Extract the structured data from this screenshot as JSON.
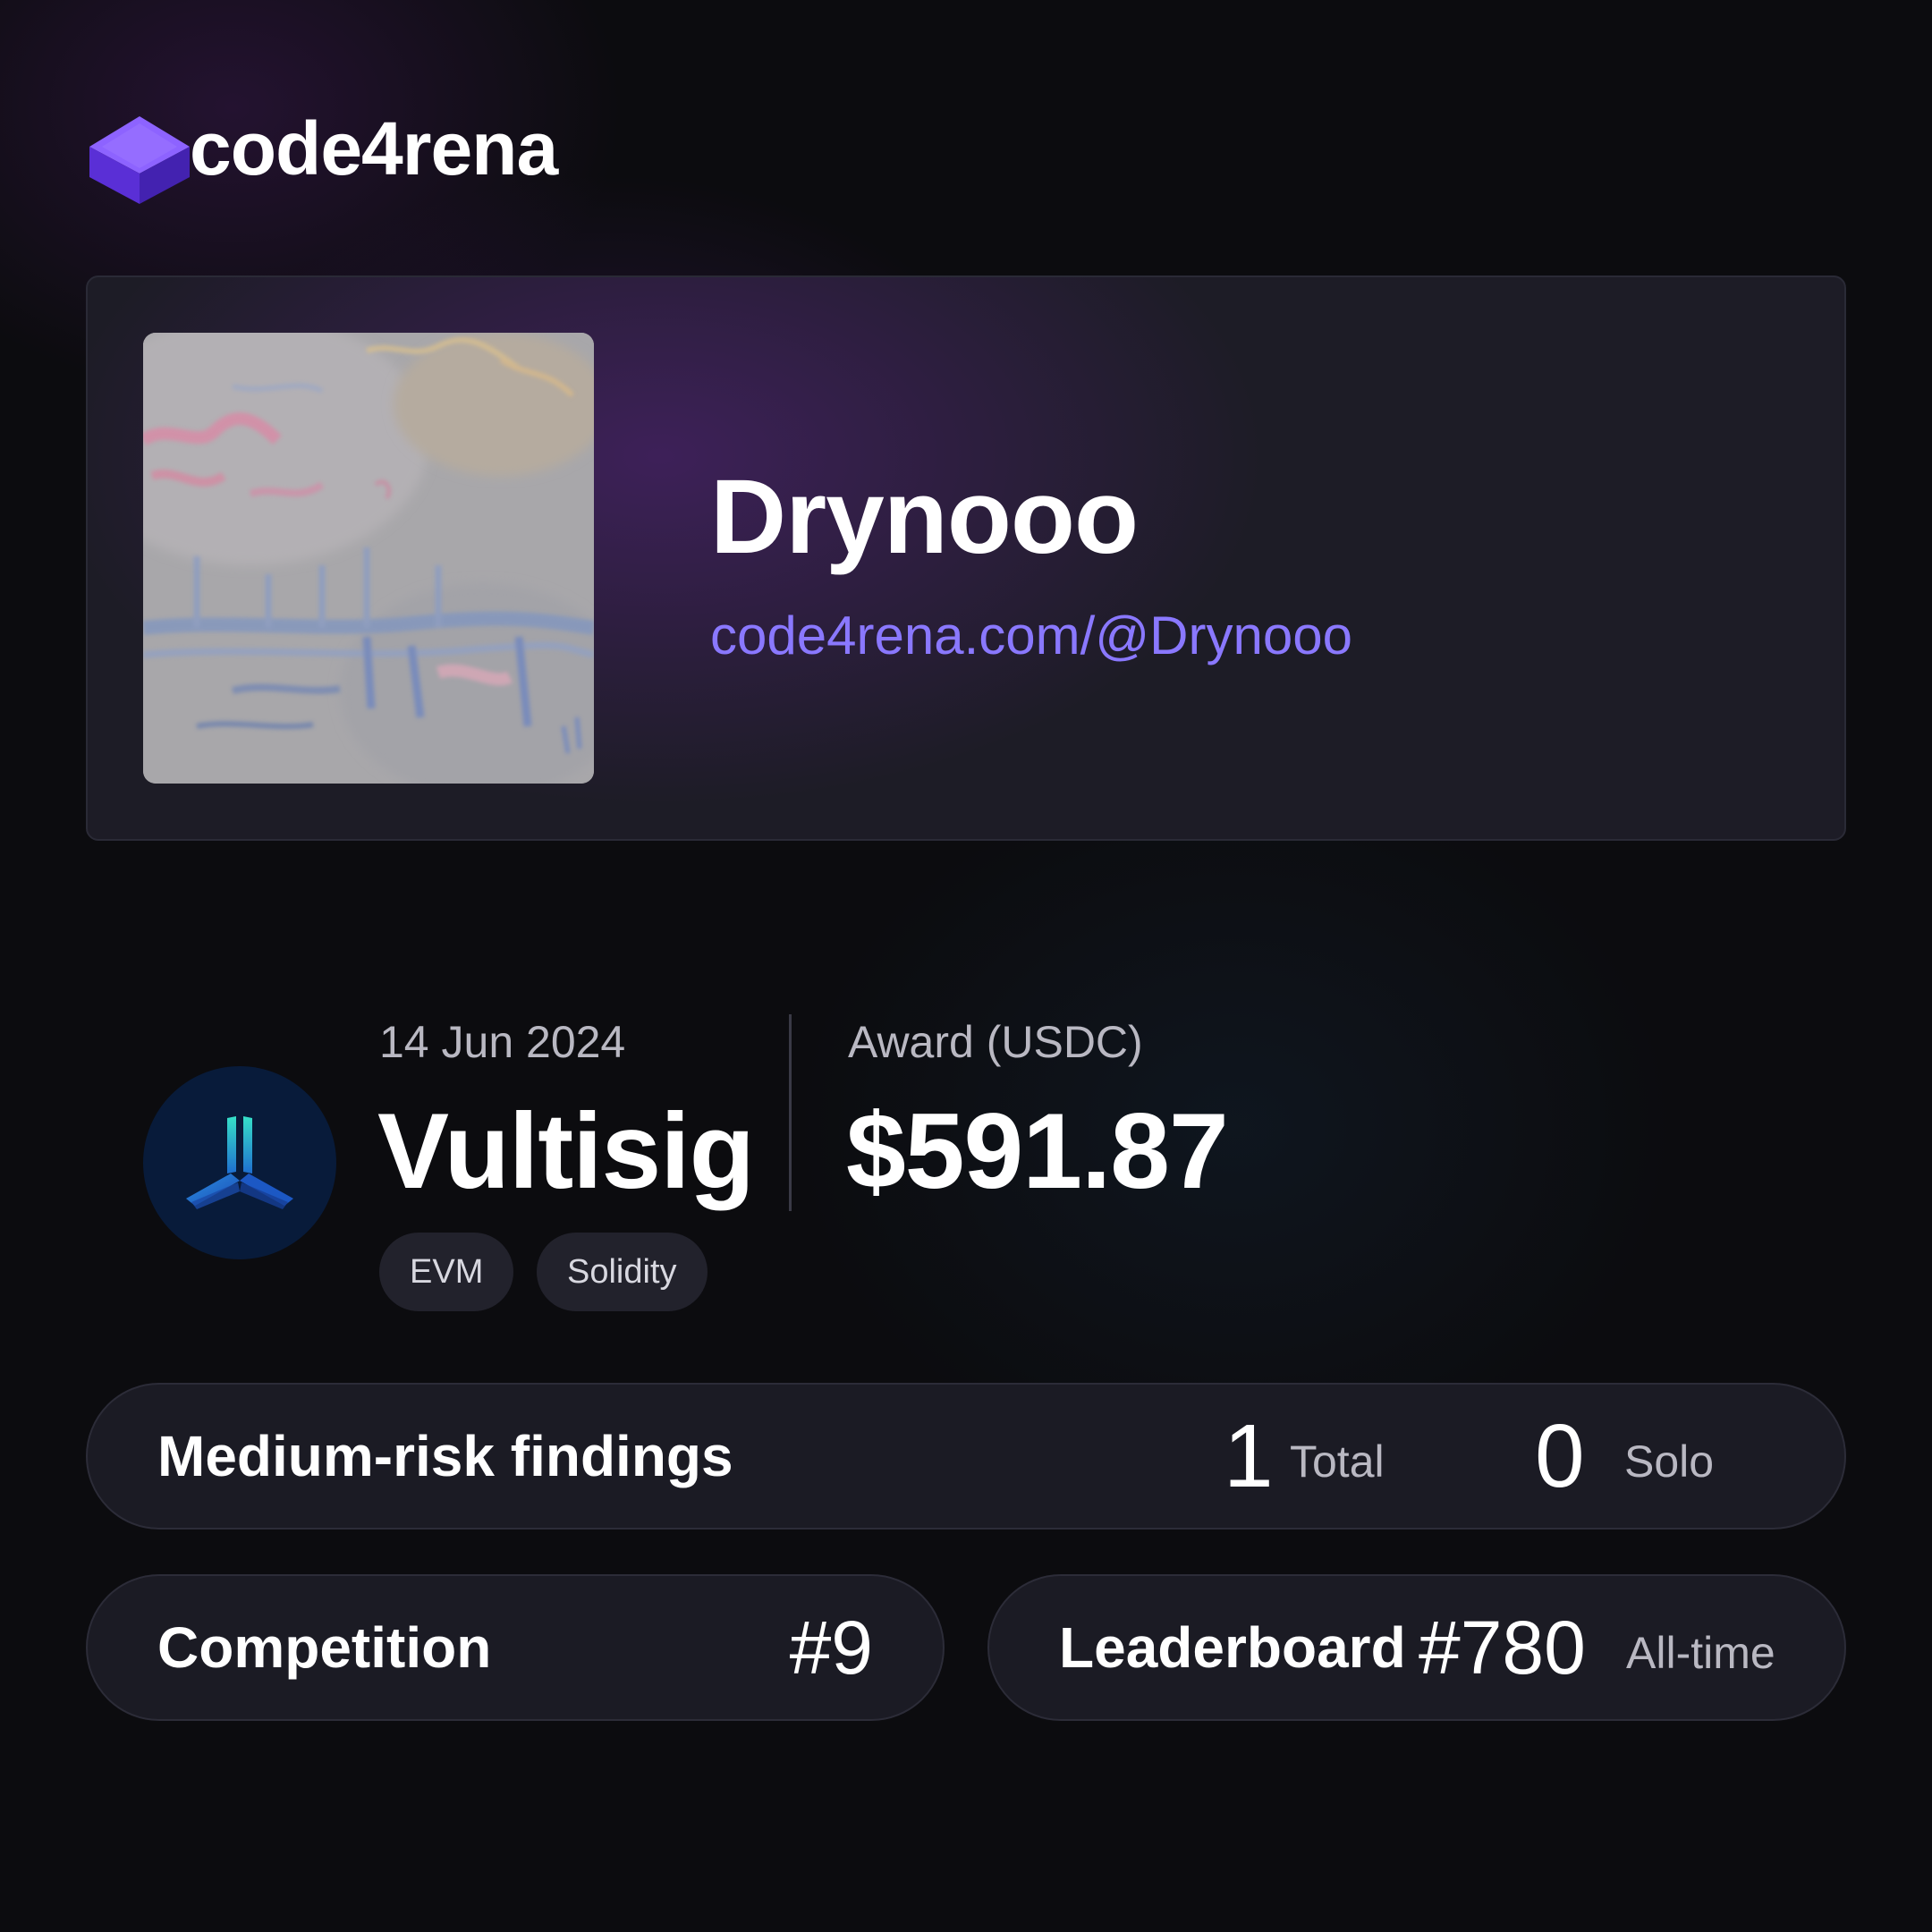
{
  "brand": {
    "name": "code4rena",
    "logo_icon": "purple-cube-icon",
    "accent": "#7b5cff"
  },
  "profile": {
    "handle": "Drynooo",
    "url": "code4rena.com/@Drynooo",
    "url_color": "#8a78ff",
    "avatar": "avatar-painting"
  },
  "contest": {
    "date": "14 Jun 2024",
    "name": "Vultisig",
    "logo_icon": "vultisig-logo-icon",
    "tags": [
      "EVM",
      "Solidity"
    ],
    "award_label": "Award (USDC)",
    "award_value": "$591.87"
  },
  "findings": {
    "label": "Medium-risk findings",
    "total_value": "1",
    "total_label": "Total",
    "solo_value": "0",
    "solo_label": "Solo"
  },
  "competition": {
    "label": "Competition",
    "rank": "#9"
  },
  "leaderboard": {
    "label": "Leaderboard",
    "rank": "#780",
    "scope": "All-time"
  }
}
